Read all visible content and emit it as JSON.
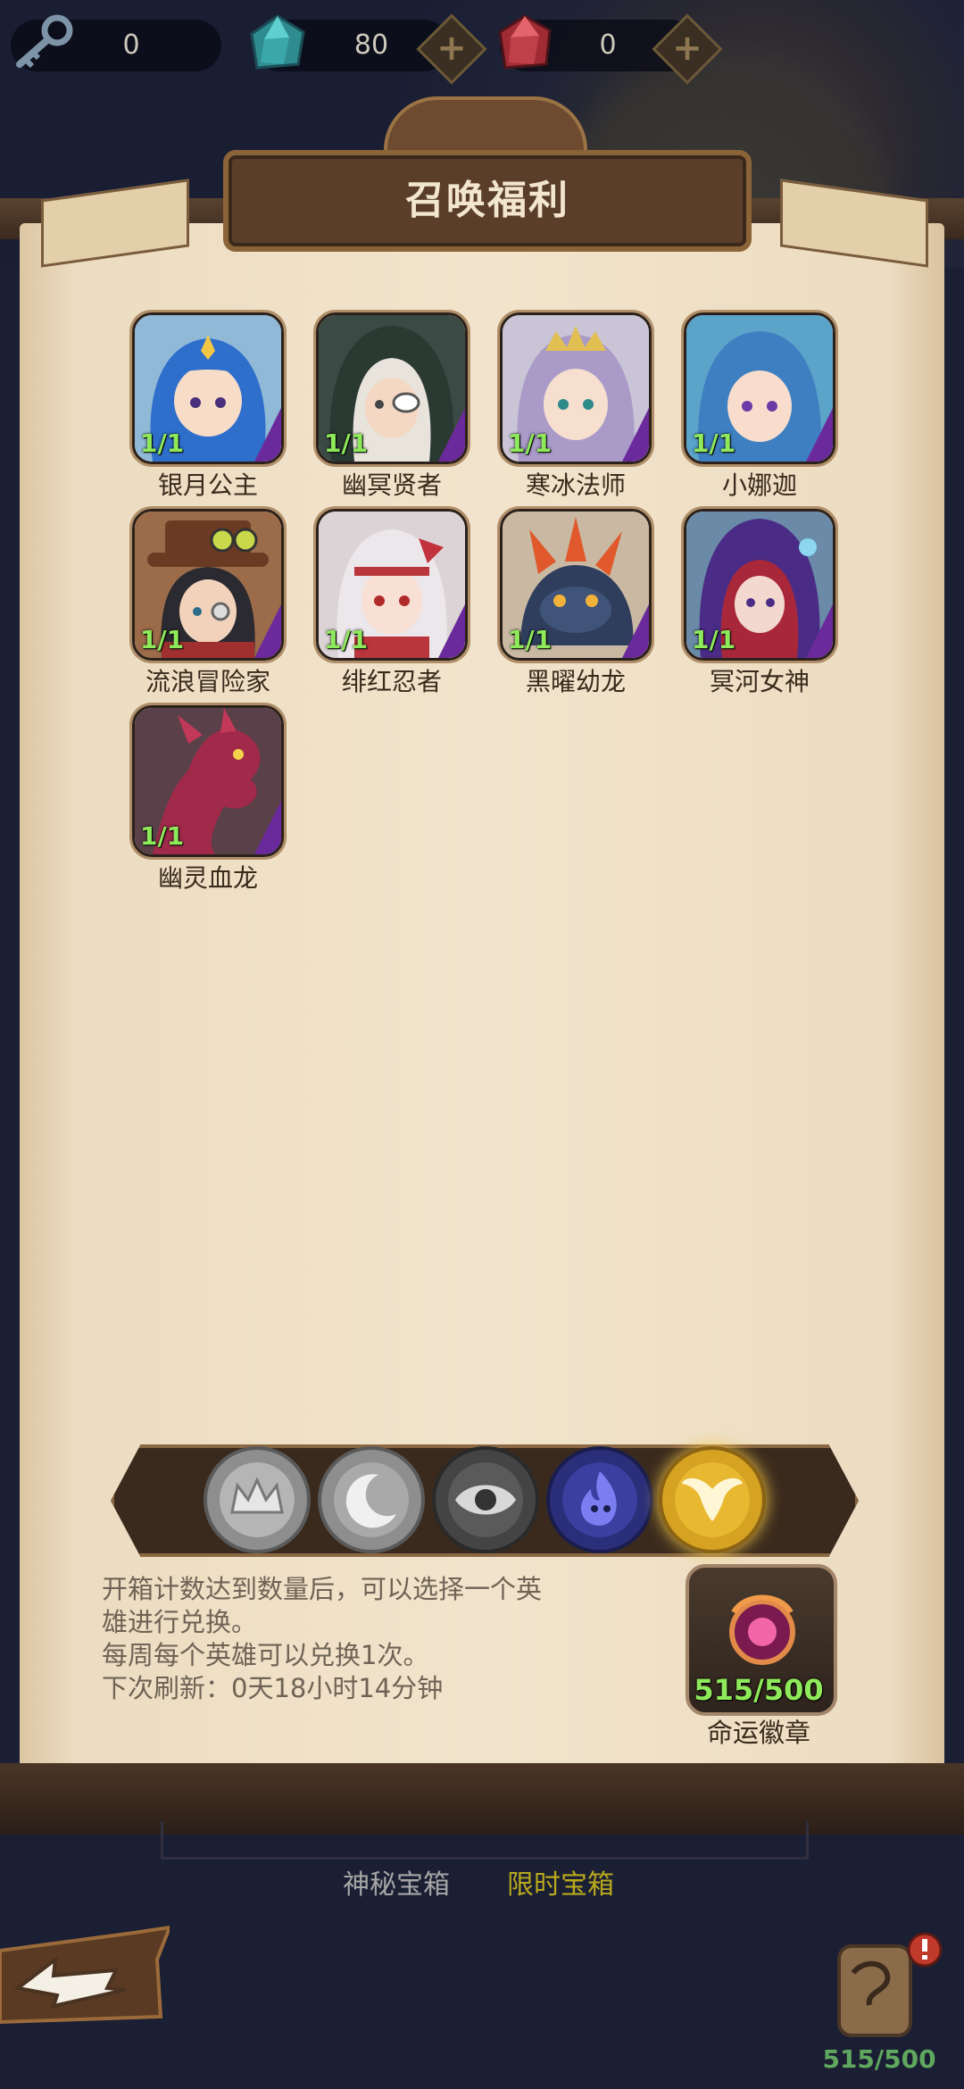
{
  "currency": {
    "keys": "0",
    "diamonds": "80",
    "rubies": "0"
  },
  "panel": {
    "title": "召唤福利"
  },
  "heroes": [
    {
      "name": "银月公主",
      "count": "1/1"
    },
    {
      "name": "幽冥贤者",
      "count": "1/1"
    },
    {
      "name": "寒冰法师",
      "count": "1/1"
    },
    {
      "name": "小娜迦",
      "count": "1/1"
    },
    {
      "name": "流浪冒险家",
      "count": "1/1"
    },
    {
      "name": "绯红忍者",
      "count": "1/1"
    },
    {
      "name": "黑曜幼龙",
      "count": "1/1"
    },
    {
      "name": "冥河女神",
      "count": "1/1"
    },
    {
      "name": "幽灵血龙",
      "count": "1/1"
    }
  ],
  "categories": [
    {
      "icon": "crown-icon",
      "selected": false
    },
    {
      "icon": "moon-icon",
      "selected": false
    },
    {
      "icon": "eye-icon",
      "selected": false
    },
    {
      "icon": "spirit-flame-icon",
      "selected": false
    },
    {
      "icon": "angel-wings-icon",
      "selected": true
    }
  ],
  "info": {
    "line1": "开箱计数达到数量后，可以选择一个英",
    "line2": "雄进行兑换。",
    "line3": "每周每个英雄可以兑换1次。",
    "line4": "下次刷新：0天18小时14分钟"
  },
  "emblem": {
    "count": "515/500",
    "name": "命运徽章"
  },
  "bottom": {
    "tab1": "神秘宝箱",
    "tab2": "限时宝箱",
    "count": "515/500"
  }
}
